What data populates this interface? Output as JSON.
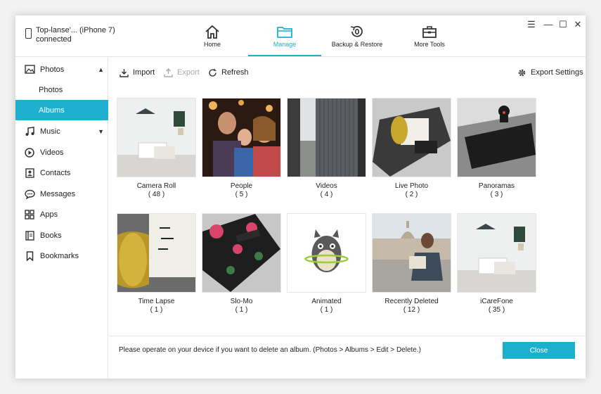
{
  "device": {
    "name": "Top-lanse'... (iPhone 7)",
    "status": "connected"
  },
  "nav": [
    {
      "label": "Home",
      "icon": "home-icon"
    },
    {
      "label": "Manage",
      "icon": "folder-icon",
      "active": true
    },
    {
      "label": "Backup & Restore",
      "icon": "backup-restore-icon"
    },
    {
      "label": "More Tools",
      "icon": "toolbox-icon"
    }
  ],
  "window_controls": {
    "menu": "☰",
    "minimize": "—",
    "maximize": "☐",
    "close": "✕"
  },
  "sidebar": {
    "photos": "Photos",
    "photos_sub": "Photos",
    "albums": "Albums",
    "music": "Music",
    "videos": "Videos",
    "contacts": "Contacts",
    "messages": "Messages",
    "apps": "Apps",
    "books": "Books",
    "bookmarks": "Bookmarks"
  },
  "toolbar": {
    "import": "Import",
    "export": "Export",
    "refresh": "Refresh",
    "export_settings": "Export Settings"
  },
  "albums": [
    {
      "name": "Camera Roll",
      "count": "( 48 )"
    },
    {
      "name": "People",
      "count": "( 5 )"
    },
    {
      "name": "Videos",
      "count": "( 4 )"
    },
    {
      "name": "Live Photo",
      "count": "( 2 )"
    },
    {
      "name": "Panoramas",
      "count": "( 3 )"
    },
    {
      "name": "Time Lapse",
      "count": "( 1 )"
    },
    {
      "name": "Slo-Mo",
      "count": "( 1 )"
    },
    {
      "name": "Animated",
      "count": "( 1 )"
    },
    {
      "name": "Recently Deleted",
      "count": "( 12 )"
    },
    {
      "name": "iCareFone",
      "count": "( 35 )"
    }
  ],
  "footer": {
    "message": "Please operate on your device if you want to delete an album. (Photos > Albums > Edit > Delete.)",
    "close": "Close"
  },
  "colors": {
    "accent": "#1cb0ce"
  }
}
